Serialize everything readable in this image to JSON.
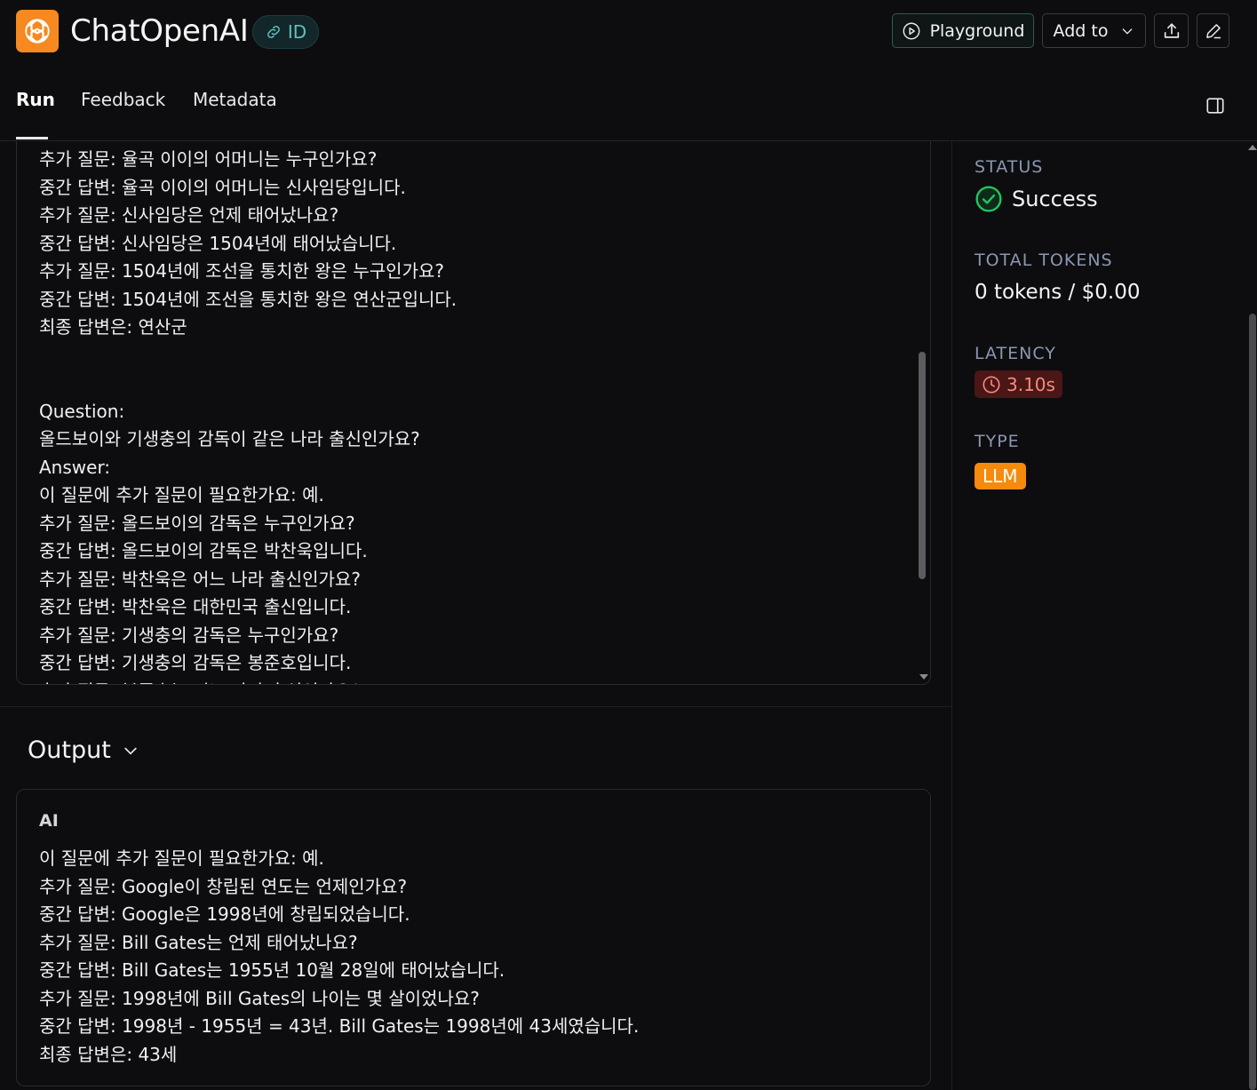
{
  "header": {
    "app_title": "ChatOpenAI",
    "id_chip": "ID",
    "playground_label": "Playground",
    "add_to_label": "Add to",
    "logo_icon": "openai-logo-icon",
    "link_icon": "link-icon",
    "play_icon": "play-circle-icon",
    "chevron_icon": "chevron-down-icon",
    "share_icon": "upload-icon",
    "edit_icon": "pencil-icon"
  },
  "tabs": {
    "items": [
      {
        "label": "Run",
        "active": true
      },
      {
        "label": "Feedback",
        "active": false
      },
      {
        "label": "Metadata",
        "active": false
      }
    ],
    "panel_icon": "sidebar-toggle-icon"
  },
  "input": {
    "lines": [
      "추가 질문: 율곡 이이의 어머니는 누구인가요?",
      "중간 답변: 율곡 이이의 어머니는 신사임당입니다.",
      "추가 질문: 신사임당은 언제 태어났나요?",
      "중간 답변: 신사임당은 1504년에 태어났습니다.",
      "추가 질문: 1504년에 조선을 통치한 왕은 누구인가요?",
      "중간 답변: 1504년에 조선을 통치한 왕은 연산군입니다.",
      "최종 답변은: 연산군",
      "",
      "",
      "Question:",
      "올드보이와 기생충의 감독이 같은 나라 출신인가요?",
      "Answer:",
      "이 질문에 추가 질문이 필요한가요: 예.",
      "추가 질문: 올드보이의 감독은 누구인가요?",
      "중간 답변: 올드보이의 감독은 박찬욱입니다.",
      "추가 질문: 박찬욱은 어느 나라 출신인가요?",
      "중간 답변: 박찬욱은 대한민국 출신입니다.",
      "추가 질문: 기생충의 감독은 누구인가요?",
      "중간 답변: 기생충의 감독은 봉준호입니다.",
      "추가 질문: 봉준호는 어느 나라 출신인가요?"
    ]
  },
  "output": {
    "title": "Output",
    "role_label": "AI",
    "lines": [
      "이 질문에 추가 질문이 필요한가요: 예.",
      "추가 질문: Google이 창립된 연도는 언제인가요?",
      "중간 답변: Google은 1998년에 창립되었습니다.",
      "추가 질문: Bill Gates는 언제 태어났나요?",
      "중간 답변: Bill Gates는 1955년 10월 28일에 태어났습니다.",
      "추가 질문: 1998년에 Bill Gates의 나이는 몇 살이었나요?",
      "중간 답변: 1998년 - 1955년 = 43년. Bill Gates는 1998년에 43세였습니다.",
      "최종 답변은: 43세"
    ]
  },
  "sidebar": {
    "status_label": "STATUS",
    "status_value": "Success",
    "status_icon": "check-circle-icon",
    "tokens_label": "TOTAL TOKENS",
    "tokens_value": "0 tokens / $0.00",
    "latency_label": "LATENCY",
    "latency_value": "3.10s",
    "latency_icon": "clock-icon",
    "type_label": "TYPE",
    "type_value": "LLM"
  },
  "colors": {
    "background": "#0d0d0f",
    "brand_orange": "#f6891f",
    "success_green": "#22c55e",
    "latency_red_bg": "#4a1616",
    "latency_red_text": "#f38b7f",
    "type_badge": "#f58a0d",
    "id_chip_teal": "#5ec2bd",
    "label_gray_blue": "#8a97b0"
  }
}
